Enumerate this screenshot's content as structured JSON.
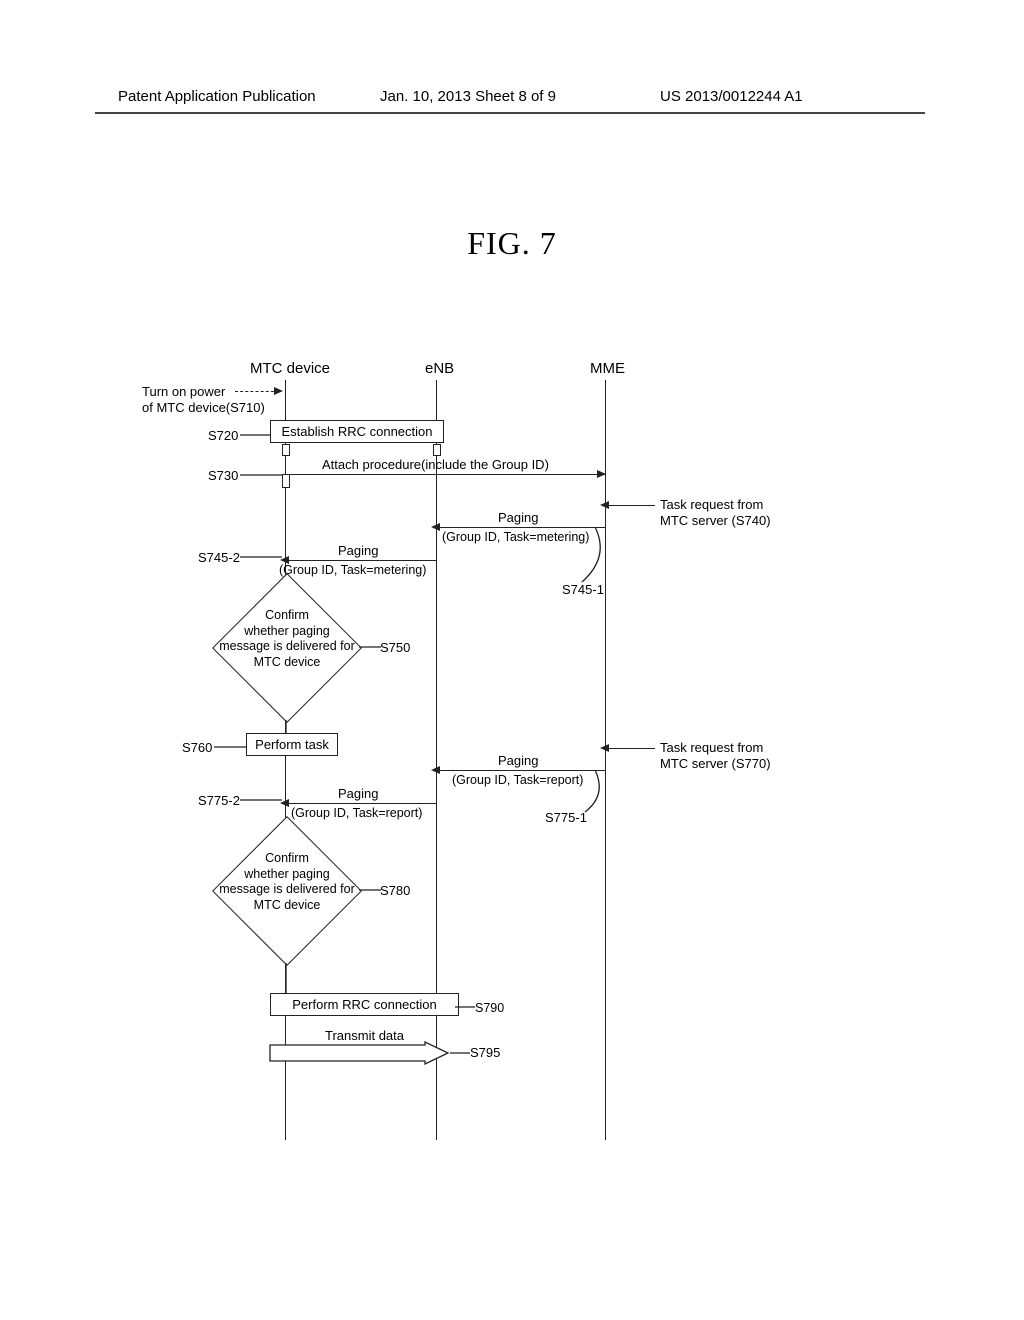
{
  "header": {
    "left": "Patent Application Publication",
    "mid": "Jan. 10, 2013  Sheet 8 of 9",
    "right": "US 2013/0012244 A1"
  },
  "figure_title": "FIG. 7",
  "entities": {
    "mtc": "MTC device",
    "enb": "eNB",
    "mme": "MME"
  },
  "labels": {
    "s710_a": "Turn on power",
    "s710_b": "of MTC device(S710)",
    "s720": "S720",
    "box_s720": "Establish RRC connection",
    "s730": "S730",
    "msg_s730": "Attach procedure(include the Group ID)",
    "s740_a": "Task request from",
    "s740_b": "MTC server (S740)",
    "paging": "Paging",
    "param_metering": "(Group ID, Task=metering)",
    "s745_1": "S745-1",
    "s745_2": "S745-2",
    "s750": "S750",
    "diamond_confirm": "Confirm\nwhether paging\nmessage is delivered for\nMTC device",
    "s760": "S760",
    "box_s760": "Perform task",
    "s770_a": "Task request from",
    "s770_b": "MTC server (S770)",
    "param_report": "(Group ID, Task=report)",
    "s775_1": "S775-1",
    "s775_2": "S775-2",
    "s780": "S780",
    "s790": "S790",
    "box_s790": "Perform RRC connection",
    "s795": "S795",
    "box_s795": "Transmit data"
  },
  "chart_data": {
    "type": "sequence",
    "participants": [
      "MTC device",
      "eNB",
      "MME"
    ],
    "steps": [
      {
        "id": "S710",
        "at": "MTC device",
        "action": "Turn on power of MTC device",
        "kind": "self"
      },
      {
        "id": "S720",
        "from": "MTC device",
        "to": "eNB",
        "label": "Establish RRC connection",
        "kind": "box"
      },
      {
        "id": "S730",
        "from": "MTC device",
        "to": "MME",
        "label": "Attach procedure(include the Group ID)",
        "kind": "message"
      },
      {
        "id": "S740",
        "at": "MME",
        "label": "Task request from MTC server",
        "kind": "external-in"
      },
      {
        "id": "S745-1",
        "from": "MME",
        "to": "eNB",
        "label": "Paging (Group ID, Task=metering)",
        "kind": "message"
      },
      {
        "id": "S745-2",
        "from": "eNB",
        "to": "MTC device",
        "label": "Paging (Group ID, Task=metering)",
        "kind": "message"
      },
      {
        "id": "S750",
        "at": "MTC device",
        "label": "Confirm whether paging message is delivered for MTC device",
        "kind": "decision"
      },
      {
        "id": "S760",
        "at": "MTC device",
        "label": "Perform task",
        "kind": "box"
      },
      {
        "id": "S770",
        "at": "MME",
        "label": "Task request from MTC server",
        "kind": "external-in"
      },
      {
        "id": "S775-1",
        "from": "MME",
        "to": "eNB",
        "label": "Paging (Group ID, Task=report)",
        "kind": "message"
      },
      {
        "id": "S775-2",
        "from": "eNB",
        "to": "MTC device",
        "label": "Paging (Group ID, Task=report)",
        "kind": "message"
      },
      {
        "id": "S780",
        "at": "MTC device",
        "label": "Confirm whether paging message is delivered for MTC device",
        "kind": "decision"
      },
      {
        "id": "S790",
        "from": "MTC device",
        "to": "eNB",
        "label": "Perform RRC connection",
        "kind": "box"
      },
      {
        "id": "S795",
        "from": "MTC device",
        "to": "eNB",
        "label": "Transmit data",
        "kind": "message"
      }
    ]
  }
}
